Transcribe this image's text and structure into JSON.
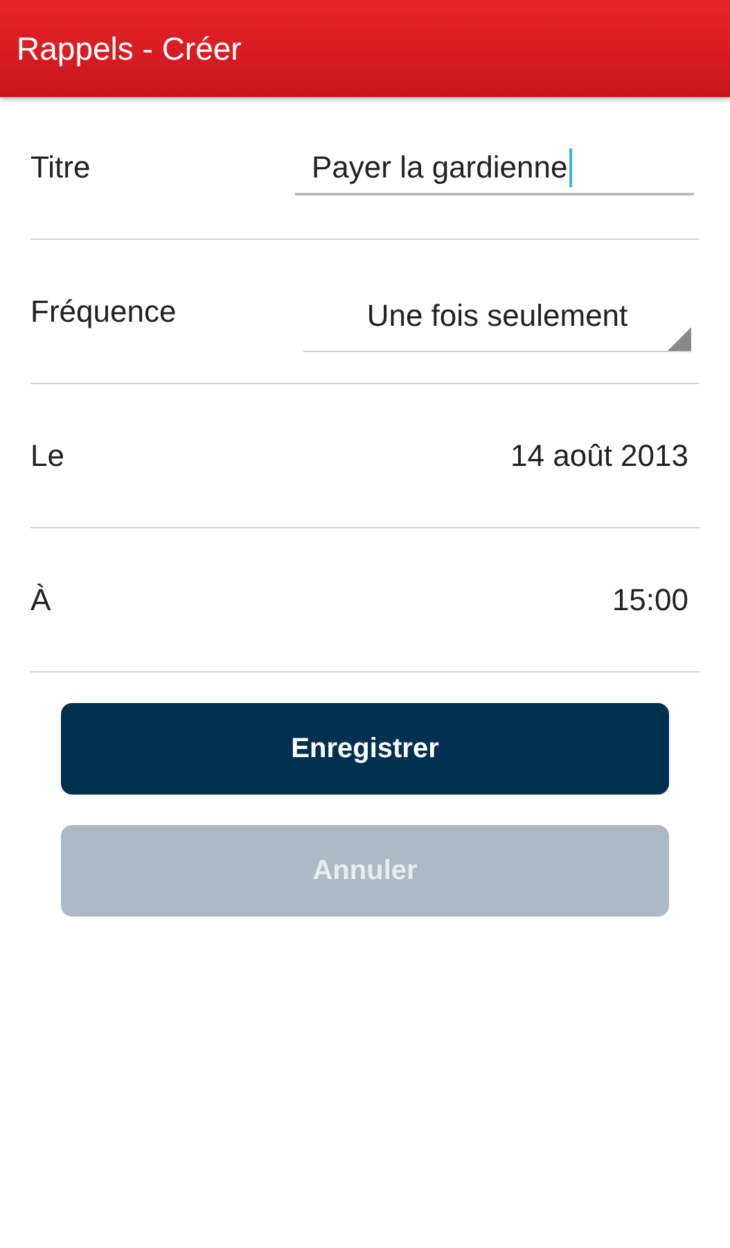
{
  "app_bar": {
    "title": "Rappels - Créer"
  },
  "form_rows": [
    {
      "kind": "text_field",
      "label": "Titre",
      "value": "Payer la gardienne",
      "focused": true
    },
    {
      "kind": "spinner",
      "label": "Fréquence",
      "value": "Une fois seulement"
    },
    {
      "kind": "value",
      "label": "Le",
      "value": "14 août 2013"
    },
    {
      "kind": "value",
      "label": "À",
      "value": "15:00"
    }
  ],
  "buttons": [
    {
      "label": "Enregistrer",
      "disabled": false
    },
    {
      "label": "Annuler",
      "disabled": true
    }
  ]
}
